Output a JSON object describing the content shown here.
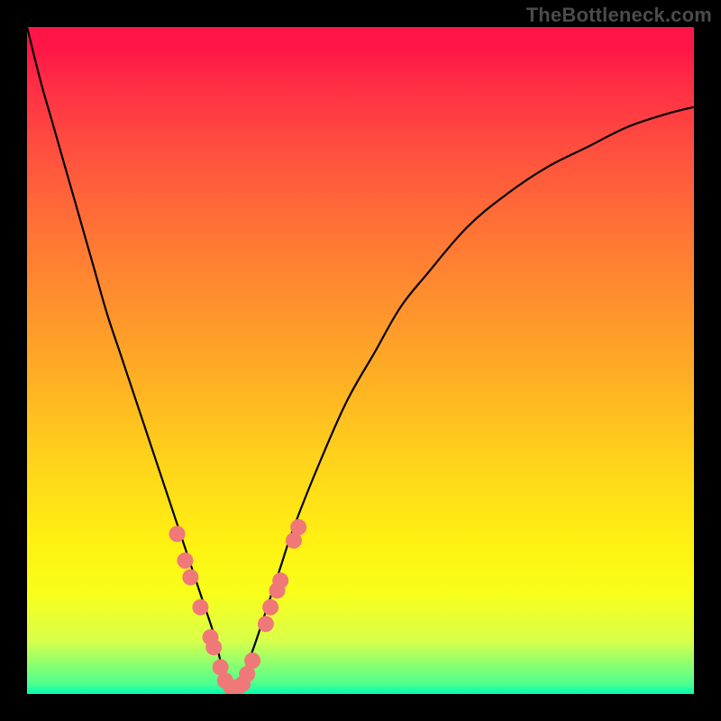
{
  "watermark": "TheBottleneck.com",
  "frame": {
    "outer_width": 800,
    "outer_height": 800,
    "border_left": 30,
    "border_right": 30,
    "border_top": 30,
    "border_bottom": 30,
    "border_color": "#000000"
  },
  "chart_data": {
    "type": "line",
    "title": "",
    "xlabel": "",
    "ylabel": "",
    "xlim": [
      0,
      100
    ],
    "ylim": [
      0,
      100
    ],
    "grid": false,
    "x": [
      0,
      2,
      4,
      6,
      8,
      10,
      12,
      14,
      16,
      18,
      20,
      22,
      24,
      26,
      28,
      29,
      30,
      31,
      32,
      34,
      36,
      38,
      40,
      44,
      48,
      52,
      56,
      60,
      66,
      72,
      78,
      84,
      90,
      96,
      100
    ],
    "values": [
      100,
      92,
      85,
      78,
      71,
      64,
      57,
      51,
      45,
      39,
      33,
      27,
      21,
      15,
      9,
      5,
      2,
      1,
      2,
      7,
      13,
      19,
      25,
      35,
      44,
      51,
      58,
      63,
      70,
      75,
      79,
      82,
      85,
      87,
      88
    ],
    "curve_minimum_x": 31,
    "marker_points": [
      {
        "x": 22.5,
        "y": 24.0
      },
      {
        "x": 23.7,
        "y": 20.0
      },
      {
        "x": 24.5,
        "y": 17.5
      },
      {
        "x": 26.0,
        "y": 13.0
      },
      {
        "x": 27.5,
        "y": 8.5
      },
      {
        "x": 28.0,
        "y": 7.0
      },
      {
        "x": 29.0,
        "y": 4.0
      },
      {
        "x": 29.7,
        "y": 2.0
      },
      {
        "x": 30.6,
        "y": 1.0
      },
      {
        "x": 31.6,
        "y": 1.0
      },
      {
        "x": 32.3,
        "y": 1.5
      },
      {
        "x": 33.0,
        "y": 3.0
      },
      {
        "x": 33.8,
        "y": 5.0
      },
      {
        "x": 35.8,
        "y": 10.5
      },
      {
        "x": 36.5,
        "y": 13.0
      },
      {
        "x": 37.5,
        "y": 15.5
      },
      {
        "x": 38.0,
        "y": 17.0
      },
      {
        "x": 40.0,
        "y": 23.0
      },
      {
        "x": 40.7,
        "y": 25.0
      }
    ],
    "colors": {
      "curve": "#000000",
      "markers": "#f07878",
      "background_top": "#ff1547",
      "background_bottom": "#00ffb0"
    }
  }
}
